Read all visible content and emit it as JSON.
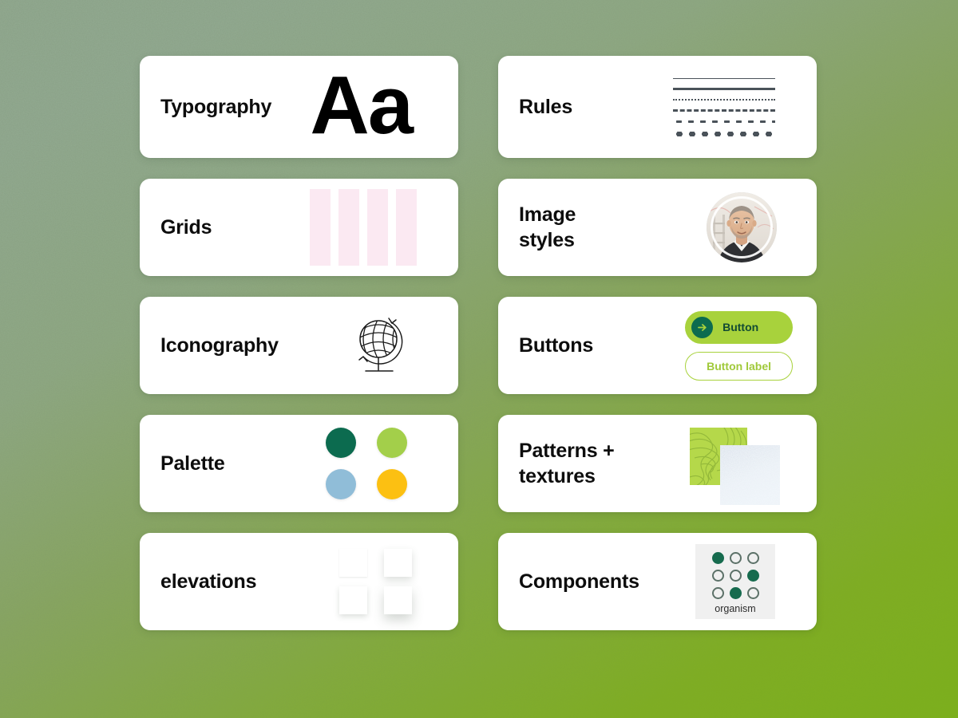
{
  "background": {
    "gradient_from": "#93ab92",
    "gradient_to": "#7cb01c",
    "texture": "speckled-noise"
  },
  "cards": {
    "typography": {
      "title": "Typography",
      "sample_glyphs": "Aa"
    },
    "rules": {
      "title": "Rules",
      "rule_color": "#4a5259",
      "styles": [
        "thin-solid",
        "thick-solid",
        "fine-dotted",
        "dashed",
        "small-spaced-dots",
        "large-dots"
      ]
    },
    "grids": {
      "title": "Grids",
      "column_count": 4,
      "column_color": "#fbe9f2"
    },
    "image_styles": {
      "title": "Image\nstyles",
      "avatar_shape": "circle",
      "avatar_ring": "white"
    },
    "iconography": {
      "title": "Iconography",
      "icon": "globe-icon"
    },
    "buttons": {
      "title": "Buttons",
      "primary_label": "Button",
      "secondary_label": "Button label",
      "primary_bg": "#a8d23c",
      "primary_text": "#124b33",
      "arrow_bg": "#0c6b4f",
      "secondary_border": "#a8d23c",
      "secondary_text": "#a0c93a"
    },
    "palette": {
      "title": "Palette",
      "swatches": [
        {
          "name": "dark-green",
          "hex": "#0c6b4f"
        },
        {
          "name": "lime-green",
          "hex": "#a3cf4a"
        },
        {
          "name": "light-blue",
          "hex": "#90bdd8"
        },
        {
          "name": "golden-yellow",
          "hex": "#fcc012"
        }
      ]
    },
    "patterns": {
      "title": "Patterns +\ntextures",
      "topo_color": "#b5d84a",
      "topo_line_color": "#93b83a",
      "noise_color": "#f2f7fb"
    },
    "elevations": {
      "title": "elevations",
      "levels": 4
    },
    "components": {
      "title": "Components",
      "label": "organism",
      "panel_bg": "#f0f0f0",
      "filled_color": "#166b4e",
      "outline_color": "#5c7168",
      "atoms": [
        [
          true,
          false,
          false
        ],
        [
          false,
          false,
          true
        ],
        [
          false,
          true,
          false
        ]
      ]
    }
  }
}
